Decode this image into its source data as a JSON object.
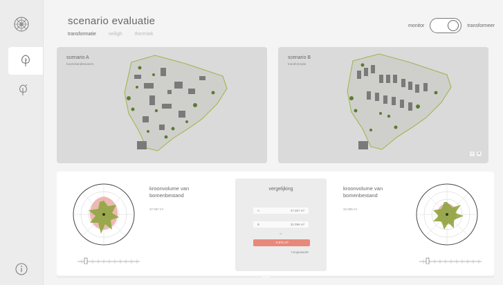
{
  "header": {
    "title": "scenario evaluatie",
    "tabs": [
      {
        "label": "transformatie",
        "active": true
      },
      {
        "label": "veiligh",
        "active": false
      },
      {
        "label": "thermiek",
        "active": false
      }
    ]
  },
  "mode_toggle": {
    "left_label": "monitor",
    "right_label": "transformeer",
    "state": "transformeer"
  },
  "sidebar": {
    "logo_icon": "globe-icon",
    "items": [
      {
        "icon": "tree-icon",
        "active": true
      },
      {
        "icon": "tree-sparkle-icon",
        "active": false
      }
    ],
    "info_icon": "info-icon"
  },
  "scenarios": [
    {
      "label": "scenario A",
      "subtitle": "boomstandbewaren"
    },
    {
      "label": "scenario B",
      "subtitle": "transformatie"
    }
  ],
  "zoom_controls": [
    "-",
    "+"
  ],
  "metrics": [
    {
      "title": "kroonvolume van bomenbestand",
      "value": "37.067 m³"
    },
    {
      "title": "kroonvolume van bomenbestand",
      "value": "32.096 m³"
    }
  ],
  "comparison": {
    "title": "vergelijking",
    "rows": [
      {
        "label": "A",
        "value": "37.067 m³"
      },
      {
        "label": "B",
        "value": "32.096 m³"
      }
    ],
    "separator": "=",
    "delta": "-4.971 m³",
    "footer": "hoogwaarde"
  },
  "colors": {
    "accent_red": "#e8887a",
    "leaf_green": "#8fa640",
    "rose_pink": "#e8a9a0"
  }
}
